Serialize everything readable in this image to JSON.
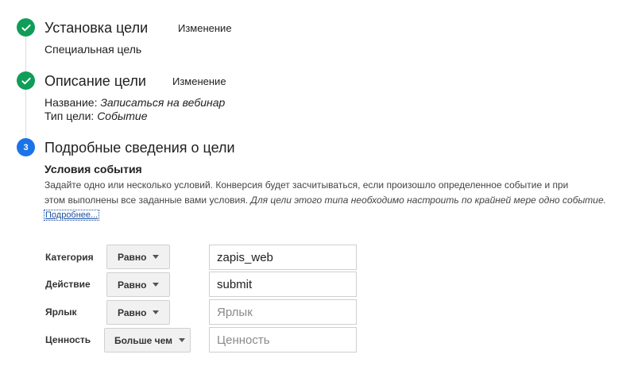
{
  "steps": [
    {
      "title": "Установка цели",
      "edit_label": "Изменение",
      "detail": "Специальная цель"
    },
    {
      "title": "Описание цели",
      "edit_label": "Изменение",
      "name_label": "Название:",
      "name_value": "Записаться на вебинар",
      "type_label": "Тип цели:",
      "type_value": "Событие"
    },
    {
      "number": "3",
      "title": "Подробные сведения о цели"
    }
  ],
  "event_conditions": {
    "heading": "Условия события",
    "description_line1": "Задайте одно или несколько условий. Конверсия будет засчитываться, если произошло определенное событие и при",
    "description_line2": "этом выполнены все заданные вами условия.",
    "description_italic": "Для цели этого типа необходимо настроить по крайней мере одно событие.",
    "more_link": "Подробнее...",
    "rows": [
      {
        "label": "Категория",
        "operator": "Равно",
        "value": "zapis_web",
        "placeholder": ""
      },
      {
        "label": "Действие",
        "operator": "Равно",
        "value": "submit",
        "placeholder": ""
      },
      {
        "label": "Ярлык",
        "operator": "Равно",
        "value": "",
        "placeholder": "Ярлык"
      },
      {
        "label": "Ценность",
        "operator": "Больше чем",
        "value": "",
        "placeholder": "Ценность"
      }
    ]
  },
  "colors": {
    "done_step": "#0f9d58",
    "active_step": "#1a73e8",
    "link": "#1a4fa0"
  }
}
